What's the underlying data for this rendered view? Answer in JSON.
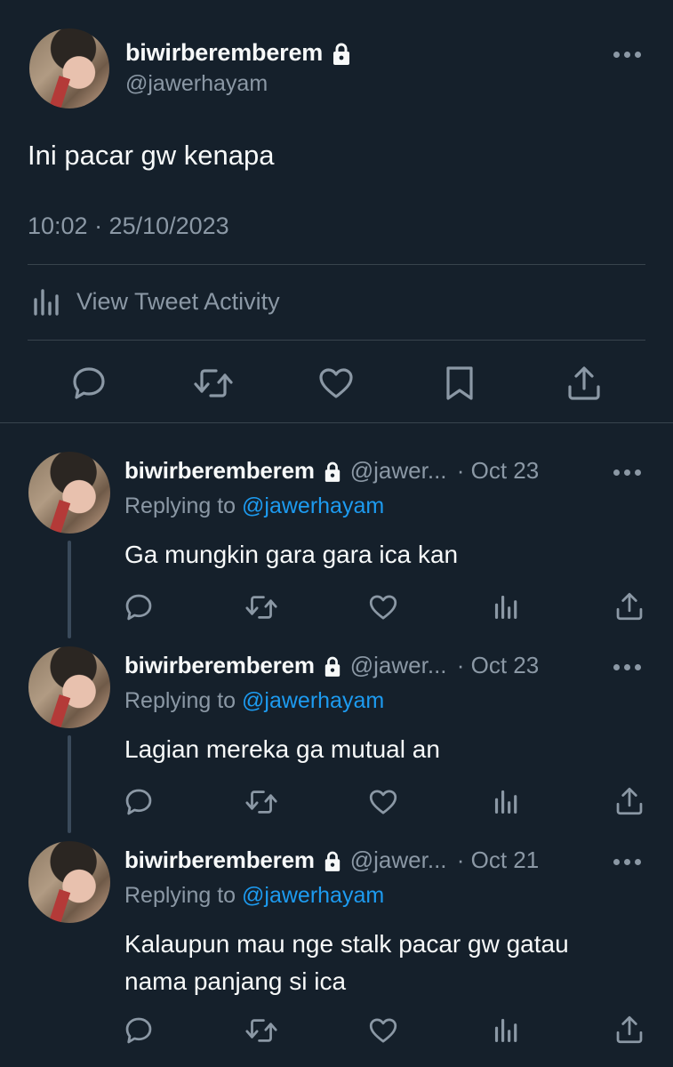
{
  "main_tweet": {
    "display_name": "biwirberemberem",
    "handle": "@jawerhayam",
    "text": "Ini pacar gw kenapa",
    "timestamp": "10:02 · 25/10/2023",
    "activity_label": "View Tweet Activity",
    "actions": [
      "reply-icon",
      "retweet-icon",
      "like-icon",
      "bookmark-icon",
      "share-icon"
    ]
  },
  "replies": [
    {
      "display_name": "biwirberemberem",
      "handle_truncated": "@jawer...",
      "date": "· Oct 23",
      "replying_prefix": "Replying to",
      "replying_to": "@jawerhayam",
      "text": "Ga mungkin gara gara ica kan"
    },
    {
      "display_name": "biwirberemberem",
      "handle_truncated": "@jawer...",
      "date": "· Oct 23",
      "replying_prefix": "Replying to",
      "replying_to": "@jawerhayam",
      "text": "Lagian mereka ga mutual an"
    },
    {
      "display_name": "biwirberemberem",
      "handle_truncated": "@jawer...",
      "date": "· Oct 21",
      "replying_prefix": "Replying to",
      "replying_to": "@jawerhayam",
      "text": "Kalaupun mau nge stalk pacar gw gatau nama panjang si ica"
    }
  ],
  "colors": {
    "background": "#15202b",
    "text": "#f7f9f9",
    "secondary_text": "#8b98a5",
    "link": "#1d9bf0",
    "divider": "#38444d",
    "thread_line": "#3a4a5b"
  }
}
